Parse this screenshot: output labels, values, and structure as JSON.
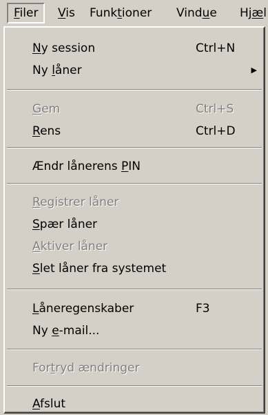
{
  "menubar": {
    "items": [
      {
        "pre": "",
        "key": "F",
        "post": "iler"
      },
      {
        "pre": "",
        "key": "V",
        "post": "is"
      },
      {
        "pre": "Funk",
        "key": "t",
        "post": "ioner"
      },
      {
        "pre": "Vind",
        "key": "u",
        "post": "e"
      },
      {
        "pre": "Hj",
        "key": "æ",
        "post": "l"
      }
    ]
  },
  "menu": {
    "ny_session": {
      "pre": "",
      "key": "N",
      "post": "y session",
      "shortcut": "Ctrl+N"
    },
    "ny_laner": {
      "pre": "Ny ",
      "key": "l",
      "post": "åner"
    },
    "gem": {
      "pre": "",
      "key": "G",
      "post": "em",
      "shortcut": "Ctrl+S"
    },
    "rens": {
      "pre": "",
      "key": "R",
      "post": "ens",
      "shortcut": "Ctrl+D"
    },
    "aendr_pin": {
      "pre": "Ændr lånerens ",
      "key": "P",
      "post": "IN"
    },
    "registrer": {
      "pre": "",
      "key": "R",
      "post": "egistrer låner"
    },
    "spaer": {
      "pre": "",
      "key": "S",
      "post": "pær låner"
    },
    "aktiver": {
      "pre": "",
      "key": "A",
      "post": "ktiver låner"
    },
    "slet": {
      "pre": "",
      "key": "S",
      "post": "let låner fra systemet"
    },
    "laneregenskaber": {
      "pre": "",
      "key": "L",
      "post": "åneregenskaber",
      "shortcut": "F3"
    },
    "ny_email": {
      "pre": "Ny ",
      "key": "e",
      "post": "-mail..."
    },
    "fortryd": {
      "pre": "For",
      "key": "t",
      "post": "ryd ændringer"
    },
    "afslut": {
      "pre": "",
      "key": "A",
      "post": "fslut"
    }
  }
}
